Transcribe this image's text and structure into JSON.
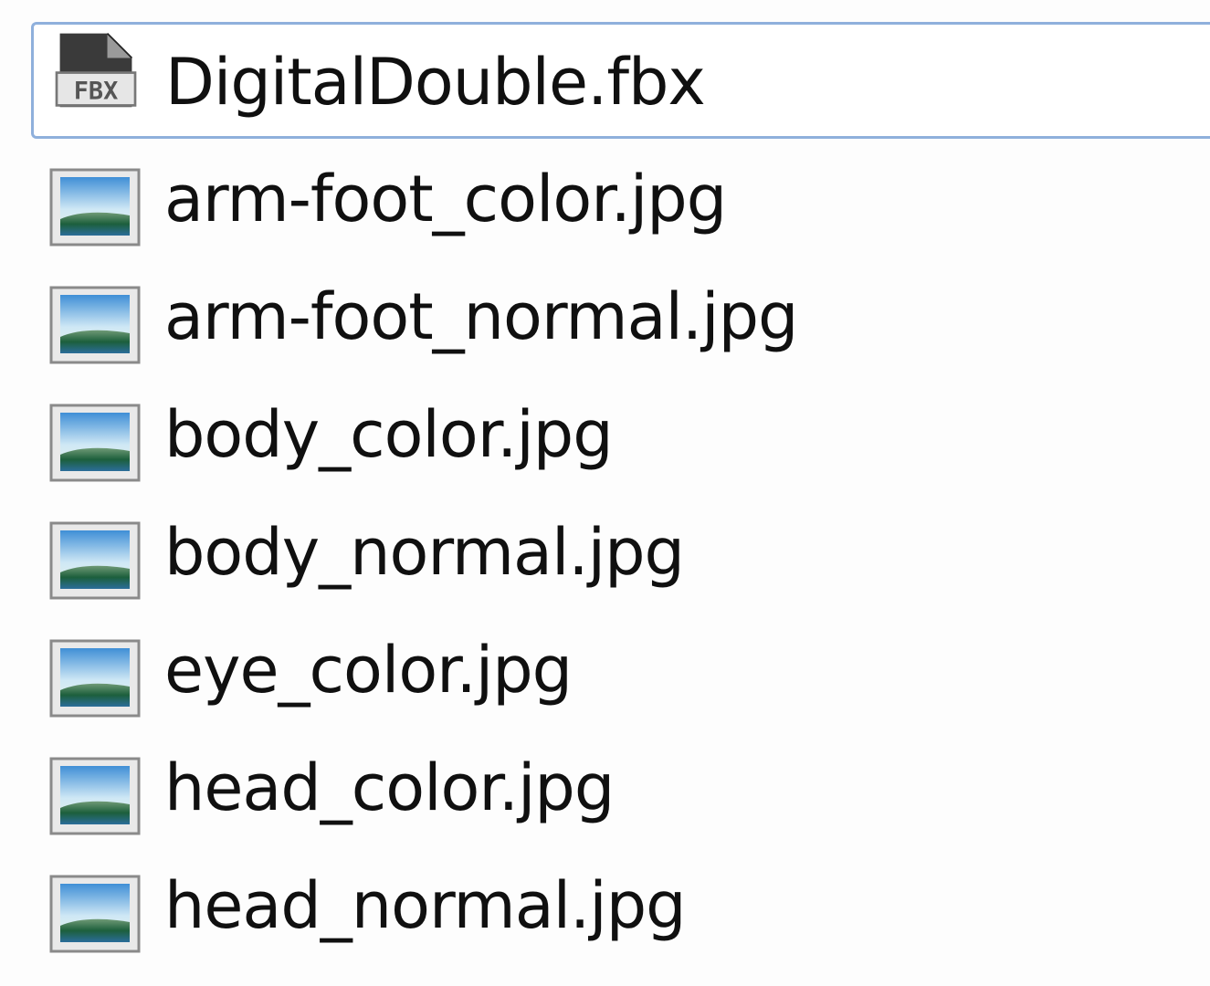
{
  "file_list": {
    "focused_index": 0,
    "items": [
      {
        "name": "DigitalDouble.fbx",
        "icon": "fbx-file-icon",
        "icon_label": "FBX"
      },
      {
        "name": "arm-foot_color.jpg",
        "icon": "image-file-icon"
      },
      {
        "name": "arm-foot_normal.jpg",
        "icon": "image-file-icon"
      },
      {
        "name": "body_color.jpg",
        "icon": "image-file-icon"
      },
      {
        "name": "body_normal.jpg",
        "icon": "image-file-icon"
      },
      {
        "name": "eye_color.jpg",
        "icon": "image-file-icon"
      },
      {
        "name": "head_color.jpg",
        "icon": "image-file-icon"
      },
      {
        "name": "head_normal.jpg",
        "icon": "image-file-icon"
      }
    ]
  },
  "colors": {
    "focus_border": "#8fb0dc",
    "text": "#101010",
    "background": "#fdfdfd"
  }
}
